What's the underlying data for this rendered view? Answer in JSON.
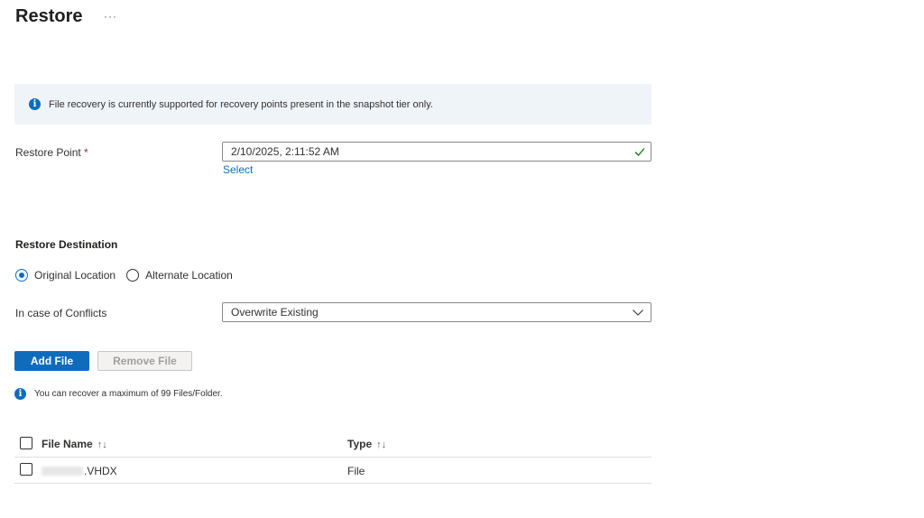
{
  "page": {
    "title": "Restore",
    "more_label": "···"
  },
  "info_banner": {
    "text": "File recovery is currently supported  for recovery points present in the snapshot tier only."
  },
  "restore_point": {
    "label": "Restore Point",
    "required_marker": "*",
    "value": "2/10/2025, 2:11:52 AM",
    "select_link": "Select"
  },
  "restore_destination": {
    "heading": "Restore Destination",
    "options": [
      {
        "label": "Original Location",
        "selected": true
      },
      {
        "label": "Alternate Location",
        "selected": false
      }
    ]
  },
  "conflicts": {
    "label": "In case of Conflicts",
    "value": "Overwrite Existing"
  },
  "buttons": {
    "add_file": "Add File",
    "remove_file": "Remove File"
  },
  "limit_note": {
    "text": "You can recover a maximum of 99 Files/Folder."
  },
  "table": {
    "columns": [
      {
        "label": "File Name",
        "sort_icon": "↑↓"
      },
      {
        "label": "Type",
        "sort_icon": "↑↓"
      }
    ],
    "rows": [
      {
        "name_suffix": ".VHDX",
        "type": "File"
      }
    ]
  },
  "colors": {
    "accent": "#0f6cbd",
    "success": "#107c10",
    "banner_bg": "#eff4f9",
    "required": "#a4262c"
  },
  "icons": {
    "info": "info-icon",
    "check": "checkmark-icon",
    "dropdown": "chevron-down-icon",
    "more": "more-icon"
  }
}
